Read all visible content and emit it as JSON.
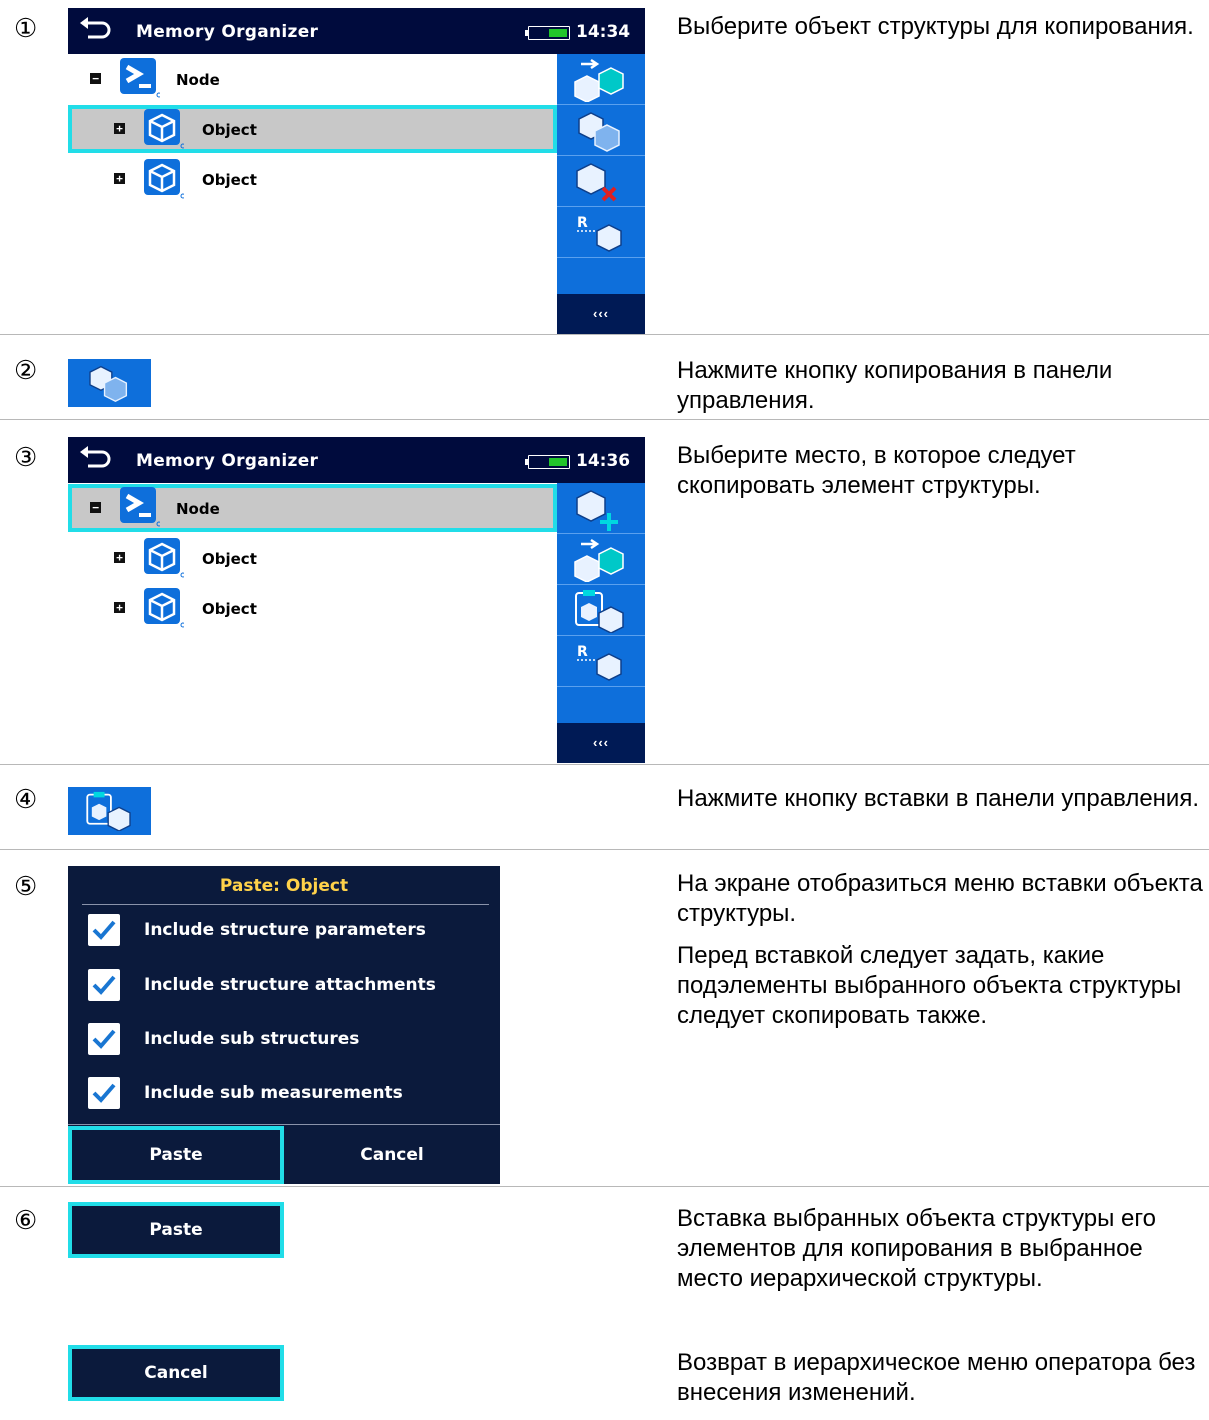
{
  "steps": [
    {
      "number": "①",
      "screen": {
        "title": "Memory Organizer",
        "time": "14:34",
        "tree": [
          {
            "label": "Node",
            "expander": "−",
            "type": "node",
            "selected": false
          },
          {
            "label": "Object",
            "expander": "+",
            "type": "object",
            "selected": true
          },
          {
            "label": "Object",
            "expander": "+",
            "type": "object",
            "selected": false
          }
        ],
        "sidebar_icons": [
          "add-sub-object-icon",
          "copy-object-icon",
          "delete-object-icon",
          "rename-object-icon"
        ],
        "more_label": "‹‹‹"
      },
      "description": [
        "Выберите объект структуры для копирования."
      ]
    },
    {
      "number": "②",
      "icon": "copy-object-icon",
      "description": [
        "Нажмите кнопку копирования в панели управления."
      ]
    },
    {
      "number": "③",
      "screen": {
        "title": "Memory Organizer",
        "time": "14:36",
        "tree": [
          {
            "label": "Node",
            "expander": "−",
            "type": "node",
            "selected": true
          },
          {
            "label": "Object",
            "expander": "+",
            "type": "object",
            "selected": false
          },
          {
            "label": "Object",
            "expander": "+",
            "type": "object",
            "selected": false
          }
        ],
        "sidebar_icons": [
          "add-object-icon",
          "add-sub-object-icon",
          "paste-object-icon",
          "rename-object-icon"
        ],
        "more_label": "‹‹‹"
      },
      "description": [
        "Выберите место, в которое следует скопировать элемент структуры."
      ]
    },
    {
      "number": "④",
      "icon": "paste-object-icon",
      "description": [
        "Нажмите кнопку вставки в панели управления."
      ]
    },
    {
      "number": "⑤",
      "dialog": {
        "title": "Paste: Object",
        "options": [
          {
            "label": "Include structure parameters",
            "checked": true
          },
          {
            "label": "Include structure attachments",
            "checked": true
          },
          {
            "label": "Include sub structures",
            "checked": true
          },
          {
            "label": "Include sub measurements",
            "checked": true
          }
        ],
        "paste_label": "Paste",
        "cancel_label": "Cancel"
      },
      "description": [
        "На экране отобразиться меню вставки объекта структуры.",
        "Перед вставкой следует задать, какие подэлементы выбранного объекта структуры следует скопировать также."
      ]
    },
    {
      "number": "⑥",
      "buttons": [
        {
          "label": "Paste",
          "description": "Вставка выбранных объекта структуры его элементов для копирования в выбранное место иерархической структуры."
        },
        {
          "label": "Cancel",
          "description": "Возврат в иерархическое меню оператора без внесения изменений."
        }
      ]
    }
  ],
  "colors": {
    "titlebar": "#000b3d",
    "sidebar": "#0e6fdb",
    "highlight": "#21dde8",
    "dialog": "#0b1a3c",
    "dialog_title": "#ffd24a",
    "battery": "#22c52a"
  }
}
